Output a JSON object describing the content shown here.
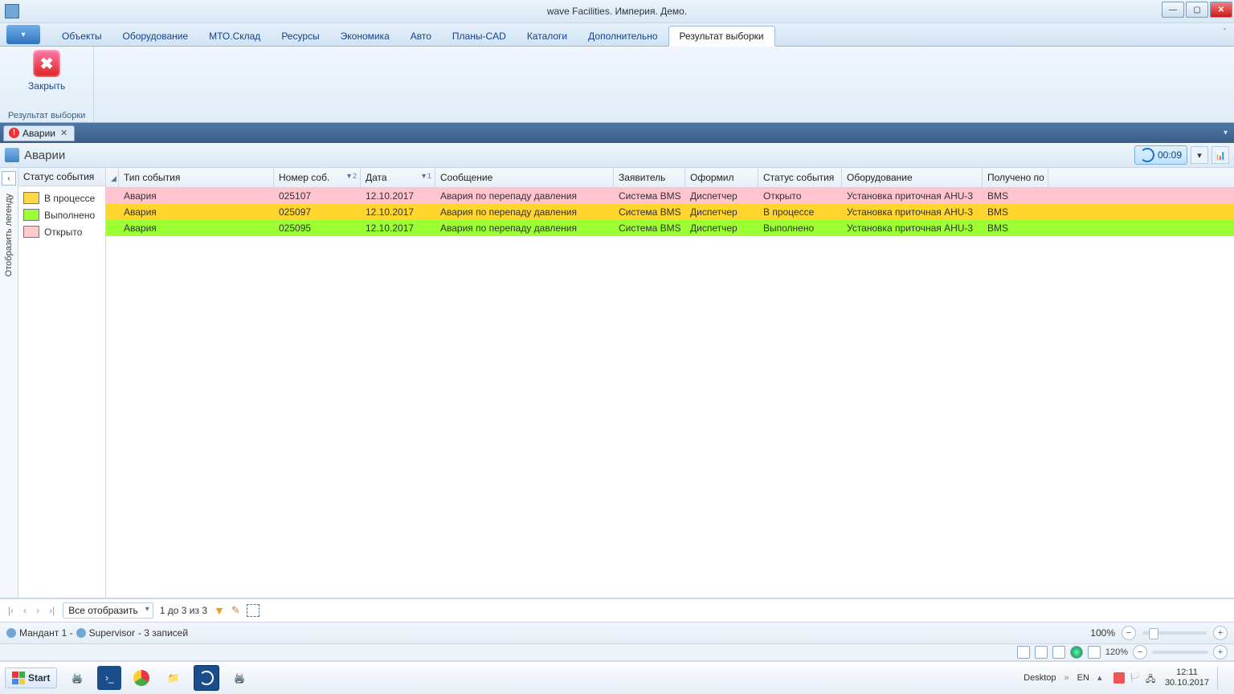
{
  "window": {
    "title": "wave Facilities. Империя. Демо."
  },
  "ribbon": {
    "tabs": [
      "Объекты",
      "Оборудование",
      "МТО.Склад",
      "Ресурсы",
      "Экономика",
      "Авто",
      "Планы-CAD",
      "Каталоги",
      "Дополнительно",
      "Результат выборки"
    ],
    "active": 9,
    "close_btn": {
      "label": "Закрыть"
    },
    "group_label": "Результат выборки"
  },
  "doc_tab": {
    "label": "Аварии"
  },
  "view": {
    "title": "Аварии",
    "refresh_time": "00:09"
  },
  "legend": {
    "collapse_label": "Отобразить легенду",
    "header": "Статус события",
    "items": [
      {
        "color": "#ffd84a",
        "label": "В процессе"
      },
      {
        "color": "#9bff33",
        "label": "Выполнено"
      },
      {
        "color": "#ffcccc",
        "label": "Открыто"
      }
    ]
  },
  "grid": {
    "columns": [
      "",
      "Тип события",
      "Номер соб.",
      "Дата",
      "Сообщение",
      "Заявитель",
      "Оформил",
      "Статус события",
      "Оборудование",
      "Получено по"
    ],
    "sort": {
      "2": "▼2",
      "3": "▼1"
    },
    "rows": [
      {
        "bg": "#ffc4cd",
        "cells": [
          "",
          "Авария",
          "025107",
          "12.10.2017",
          "Авария по перепаду давления",
          "Система BMS",
          "Диспетчер",
          "Открыто",
          "Установка приточная AHU-3",
          "BMS"
        ]
      },
      {
        "bg": "#ffd52e",
        "cells": [
          "",
          "Авария",
          "025097",
          "12.10.2017",
          "Авария по перепаду давления",
          "Система BMS",
          "Диспетчер",
          "В процессе",
          "Установка приточная AHU-3",
          "BMS"
        ]
      },
      {
        "bg": "#9bff33",
        "cells": [
          "",
          "Авария",
          "025095",
          "12.10.2017",
          "Авария по перепаду давления",
          "Система BMS",
          "Диспетчер",
          "Выполнено",
          "Установка приточная AHU-3",
          "BMS"
        ]
      }
    ]
  },
  "pager": {
    "mode": "Все отобразить",
    "text": "1 до 3 из 3"
  },
  "statusbar": {
    "mandant": "Мандант 1 -",
    "user": "Supervisor",
    "records": "- 3 записей",
    "zoom": "100%"
  },
  "utilbar": {
    "zoom": "120%"
  },
  "taskbar": {
    "start": "Start",
    "desktop": "Desktop",
    "lang": "EN",
    "time": "12:11",
    "date": "30.10.2017"
  }
}
